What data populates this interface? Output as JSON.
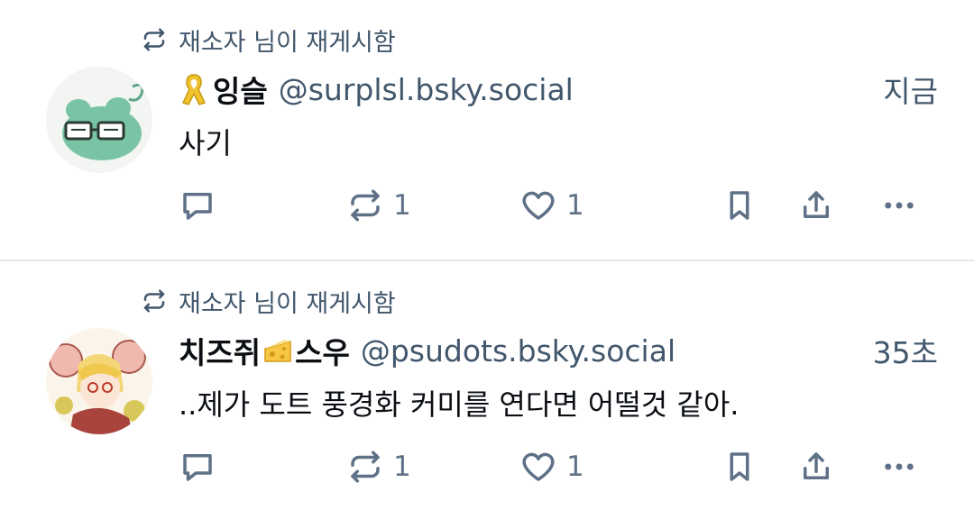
{
  "colors": {
    "text": "#0b0f14",
    "muted": "#42576c",
    "action": "#5f7186",
    "divider": "#e4e8ee"
  },
  "posts": [
    {
      "repost_label": "재소자 님이 재게시함",
      "display_name": "잉슬",
      "name_emoji": "yellow-ribbon-icon",
      "handle": "@surplsl.bsky.social",
      "time": "지금",
      "text": "사기",
      "reply_count": "",
      "repost_count": "1",
      "like_count": "1"
    },
    {
      "repost_label": "재소자 님이 재게시함",
      "display_name_prefix": "치즈쥐",
      "name_emoji": "cheese-icon",
      "display_name_suffix": "스우",
      "handle": "@psudots.bsky.social",
      "time": "35초",
      "text": "..제가 도트 풍경화 커미를 연다면 어떨것 같아.",
      "reply_count": "",
      "repost_count": "1",
      "like_count": "1"
    }
  ]
}
